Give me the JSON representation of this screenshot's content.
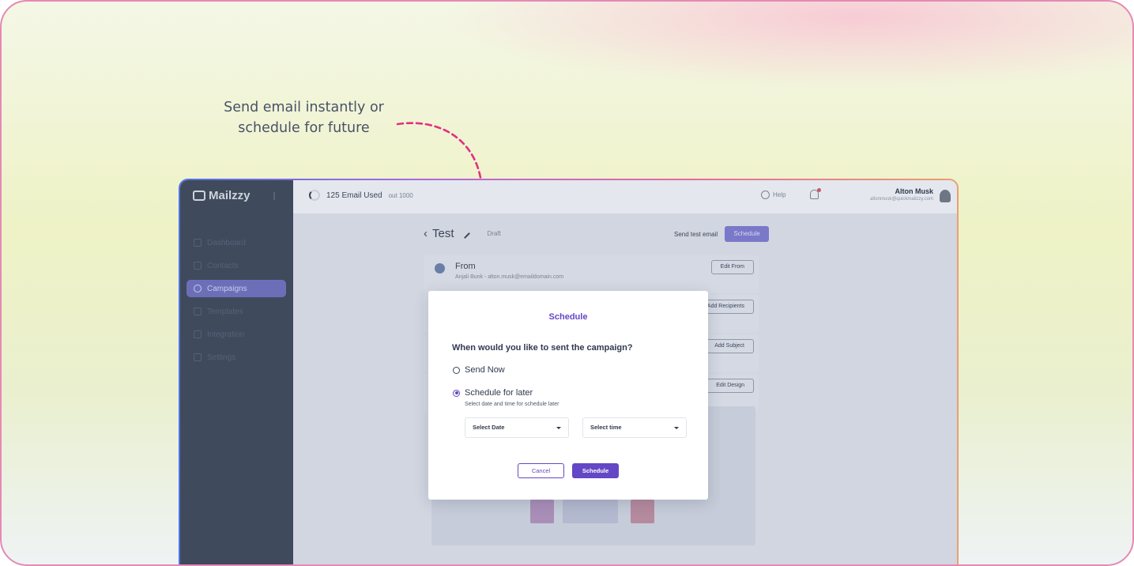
{
  "caption": {
    "line1": "Send email instantly or",
    "line2": "schedule for future"
  },
  "app": {
    "brand": "Mailzzy",
    "sidebar": {
      "items": [
        {
          "label": "Dashboard",
          "icon": "grid-icon",
          "active": false
        },
        {
          "label": "Contacts",
          "icon": "contacts-icon",
          "active": false
        },
        {
          "label": "Campaigns",
          "icon": "megaphone-icon",
          "active": true
        },
        {
          "label": "Templates",
          "icon": "template-icon",
          "active": false
        },
        {
          "label": "Integration",
          "icon": "plug-icon",
          "active": false
        },
        {
          "label": "Settings",
          "icon": "gear-icon",
          "active": false
        }
      ]
    },
    "topbar": {
      "credits_count": "125 Email Used",
      "credits_total": "out 1000",
      "help_label": "Help",
      "user_name": "Alton Musk",
      "user_email": "altonmusk@quickmailzzy.com"
    },
    "campaign": {
      "back_glyph": "‹",
      "title": "Test",
      "status": "Draft",
      "send_test_label": "Send test email",
      "schedule_label": "Schedule"
    },
    "sections": [
      {
        "label": "From",
        "sub": "Anjali Bunk - alton.musk@emaildomain.com",
        "button": "Edit From"
      },
      {
        "label": "",
        "sub": "",
        "button": "Add Recipients"
      },
      {
        "label": "",
        "sub": "",
        "button": "Add Subject"
      },
      {
        "label": "",
        "sub": "",
        "button": "Edit Design"
      }
    ]
  },
  "modal": {
    "title": "Schedule",
    "question": "When would you like to sent the campaign?",
    "options": [
      {
        "label": "Send Now",
        "selected": false
      },
      {
        "label": "Schedule for later",
        "selected": true
      }
    ],
    "hint": "Select date and time for schedule later",
    "date_placeholder": "Select Date",
    "time_placeholder": "Select time",
    "cancel_label": "Cancel",
    "schedule_label": "Schedule"
  },
  "colors": {
    "accent": "#6447c4",
    "annotation_arrow": "#e0307f"
  }
}
